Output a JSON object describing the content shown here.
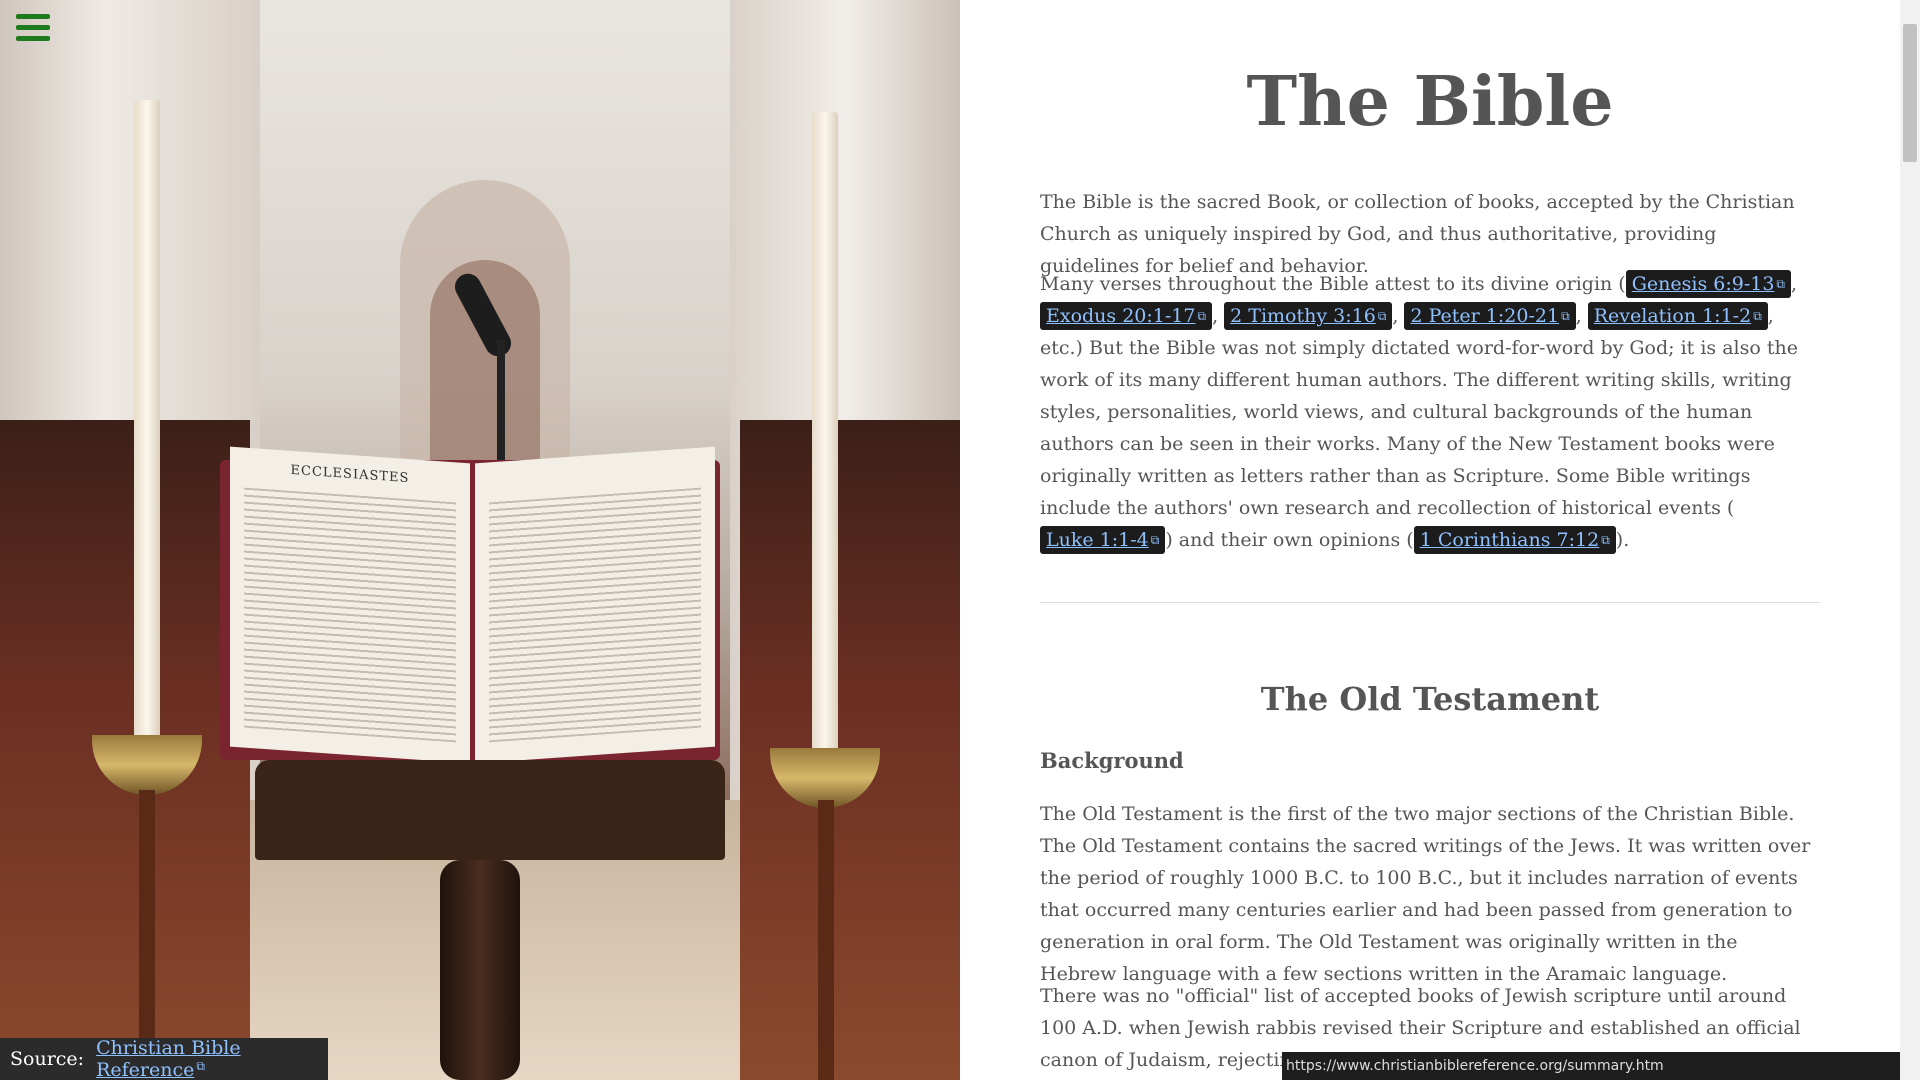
{
  "left_panel": {
    "book_page_title": "ECCLESIASTES",
    "menu_icon": "hamburger-icon",
    "source_label": "Source:",
    "source_link": "Christian Bible Reference",
    "external_icon": "external-link-icon"
  },
  "main": {
    "title": "The Bible",
    "intro": "The Bible is the sacred Book, or collection of books, accepted by the Christian Church as uniquely inspired by God, and thus authoritative, providing guidelines for belief and behavior.",
    "para2": {
      "text1": "Many verses throughout the Bible attest to its divine origin (",
      "ref1": "Genesis 6:9-13",
      "ref2": "Exodus 20:1-17",
      "ref3": "2 Timothy 3:16",
      "ref4": "2 Peter 1:20-21",
      "ref5": "Revelation 1:1-2",
      "text2": ", etc.) But the Bible was not simply dictated word-for-word by God; it is also the work of its many different human authors. The different writing skills, writing styles, personalities, world views, and cultural backgrounds of the human authors can be seen in their works. Many of the New Testament books were originally written as letters rather than as Scripture. Some Bible writings include the authors' own research and recollection of historical events (",
      "ref6": "Luke 1:1-4",
      "text3": ") and their own opinions (",
      "ref7": "1 Corinthians 7:12",
      "text4": ")."
    },
    "section_title": "The Old Testament",
    "subsection_title": "Background",
    "ot_para1": "The Old Testament is the first of the two major sections of the Christian Bible. The Old Testament contains the sacred writings of the Jews. It was written over the period of roughly 1000 B.C. to 100 B.C., but it includes narration of events that occurred many centuries earlier and had been passed from generation to generation in oral form. The Old Testament was originally written in the Hebrew language with a few sections written in the Aramaic language.",
    "ot_para2": "There was no \"official\" list of accepted books of Jewish scripture until around 100 A.D. when Jewish rabbis revised their Scripture and established an official canon of Judaism, rejecting some books not found in Hebrew ve"
  },
  "status_bar": {
    "url": "https://www.christianbiblereference.org/summary.htm"
  },
  "colors": {
    "link": "#8fc1ff",
    "ref_bg": "#1c1c1c",
    "menu": "#1d7a1d"
  }
}
